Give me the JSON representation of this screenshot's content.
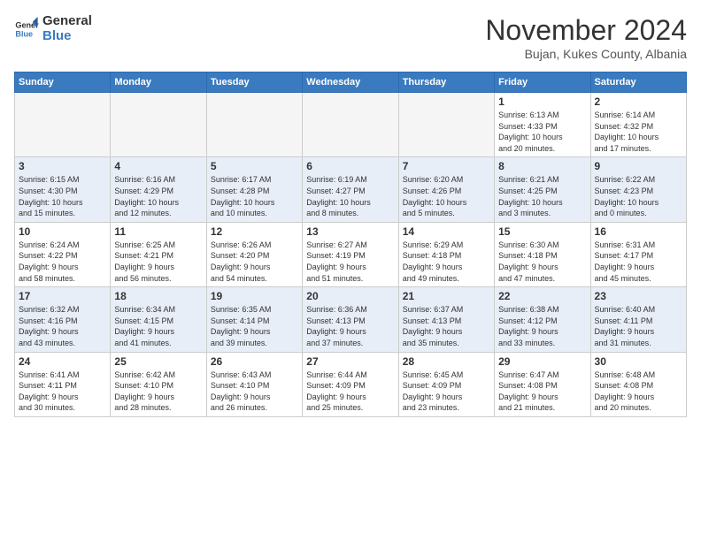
{
  "logo": {
    "general": "General",
    "blue": "Blue"
  },
  "title": "November 2024",
  "location": "Bujan, Kukes County, Albania",
  "weekdays": [
    "Sunday",
    "Monday",
    "Tuesday",
    "Wednesday",
    "Thursday",
    "Friday",
    "Saturday"
  ],
  "weeks": [
    [
      {
        "day": "",
        "info": ""
      },
      {
        "day": "",
        "info": ""
      },
      {
        "day": "",
        "info": ""
      },
      {
        "day": "",
        "info": ""
      },
      {
        "day": "",
        "info": ""
      },
      {
        "day": "1",
        "info": "Sunrise: 6:13 AM\nSunset: 4:33 PM\nDaylight: 10 hours\nand 20 minutes."
      },
      {
        "day": "2",
        "info": "Sunrise: 6:14 AM\nSunset: 4:32 PM\nDaylight: 10 hours\nand 17 minutes."
      }
    ],
    [
      {
        "day": "3",
        "info": "Sunrise: 6:15 AM\nSunset: 4:30 PM\nDaylight: 10 hours\nand 15 minutes."
      },
      {
        "day": "4",
        "info": "Sunrise: 6:16 AM\nSunset: 4:29 PM\nDaylight: 10 hours\nand 12 minutes."
      },
      {
        "day": "5",
        "info": "Sunrise: 6:17 AM\nSunset: 4:28 PM\nDaylight: 10 hours\nand 10 minutes."
      },
      {
        "day": "6",
        "info": "Sunrise: 6:19 AM\nSunset: 4:27 PM\nDaylight: 10 hours\nand 8 minutes."
      },
      {
        "day": "7",
        "info": "Sunrise: 6:20 AM\nSunset: 4:26 PM\nDaylight: 10 hours\nand 5 minutes."
      },
      {
        "day": "8",
        "info": "Sunrise: 6:21 AM\nSunset: 4:25 PM\nDaylight: 10 hours\nand 3 minutes."
      },
      {
        "day": "9",
        "info": "Sunrise: 6:22 AM\nSunset: 4:23 PM\nDaylight: 10 hours\nand 0 minutes."
      }
    ],
    [
      {
        "day": "10",
        "info": "Sunrise: 6:24 AM\nSunset: 4:22 PM\nDaylight: 9 hours\nand 58 minutes."
      },
      {
        "day": "11",
        "info": "Sunrise: 6:25 AM\nSunset: 4:21 PM\nDaylight: 9 hours\nand 56 minutes."
      },
      {
        "day": "12",
        "info": "Sunrise: 6:26 AM\nSunset: 4:20 PM\nDaylight: 9 hours\nand 54 minutes."
      },
      {
        "day": "13",
        "info": "Sunrise: 6:27 AM\nSunset: 4:19 PM\nDaylight: 9 hours\nand 51 minutes."
      },
      {
        "day": "14",
        "info": "Sunrise: 6:29 AM\nSunset: 4:18 PM\nDaylight: 9 hours\nand 49 minutes."
      },
      {
        "day": "15",
        "info": "Sunrise: 6:30 AM\nSunset: 4:18 PM\nDaylight: 9 hours\nand 47 minutes."
      },
      {
        "day": "16",
        "info": "Sunrise: 6:31 AM\nSunset: 4:17 PM\nDaylight: 9 hours\nand 45 minutes."
      }
    ],
    [
      {
        "day": "17",
        "info": "Sunrise: 6:32 AM\nSunset: 4:16 PM\nDaylight: 9 hours\nand 43 minutes."
      },
      {
        "day": "18",
        "info": "Sunrise: 6:34 AM\nSunset: 4:15 PM\nDaylight: 9 hours\nand 41 minutes."
      },
      {
        "day": "19",
        "info": "Sunrise: 6:35 AM\nSunset: 4:14 PM\nDaylight: 9 hours\nand 39 minutes."
      },
      {
        "day": "20",
        "info": "Sunrise: 6:36 AM\nSunset: 4:13 PM\nDaylight: 9 hours\nand 37 minutes."
      },
      {
        "day": "21",
        "info": "Sunrise: 6:37 AM\nSunset: 4:13 PM\nDaylight: 9 hours\nand 35 minutes."
      },
      {
        "day": "22",
        "info": "Sunrise: 6:38 AM\nSunset: 4:12 PM\nDaylight: 9 hours\nand 33 minutes."
      },
      {
        "day": "23",
        "info": "Sunrise: 6:40 AM\nSunset: 4:11 PM\nDaylight: 9 hours\nand 31 minutes."
      }
    ],
    [
      {
        "day": "24",
        "info": "Sunrise: 6:41 AM\nSunset: 4:11 PM\nDaylight: 9 hours\nand 30 minutes."
      },
      {
        "day": "25",
        "info": "Sunrise: 6:42 AM\nSunset: 4:10 PM\nDaylight: 9 hours\nand 28 minutes."
      },
      {
        "day": "26",
        "info": "Sunrise: 6:43 AM\nSunset: 4:10 PM\nDaylight: 9 hours\nand 26 minutes."
      },
      {
        "day": "27",
        "info": "Sunrise: 6:44 AM\nSunset: 4:09 PM\nDaylight: 9 hours\nand 25 minutes."
      },
      {
        "day": "28",
        "info": "Sunrise: 6:45 AM\nSunset: 4:09 PM\nDaylight: 9 hours\nand 23 minutes."
      },
      {
        "day": "29",
        "info": "Sunrise: 6:47 AM\nSunset: 4:08 PM\nDaylight: 9 hours\nand 21 minutes."
      },
      {
        "day": "30",
        "info": "Sunrise: 6:48 AM\nSunset: 4:08 PM\nDaylight: 9 hours\nand 20 minutes."
      }
    ]
  ]
}
